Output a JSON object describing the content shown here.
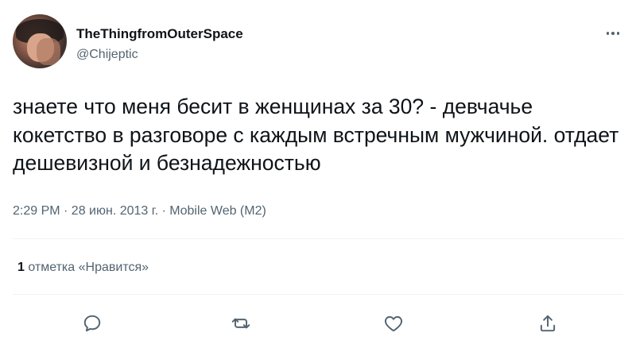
{
  "author": {
    "display_name": "TheThingfromOuterSpace",
    "handle": "@Chijeptic"
  },
  "tweet": {
    "text": "знаете что меня бесит в женщинах за 30? - девчачье кокетство в разговоре с каждым встречным мужчиной. отдает дешевизной и безнадежностью",
    "meta": "2:29 PM · 28 июн. 2013 г. · Mobile Web (M2)"
  },
  "stats": {
    "likes_count": "1",
    "likes_label": "отметка «Нравится»"
  },
  "actions": {
    "reply_icon": "reply-icon",
    "retweet_icon": "retweet-icon",
    "like_icon": "heart-icon",
    "share_icon": "share-icon"
  },
  "colors": {
    "text": "#0f1419",
    "secondary": "#536471",
    "divider": "#eff3f4"
  }
}
